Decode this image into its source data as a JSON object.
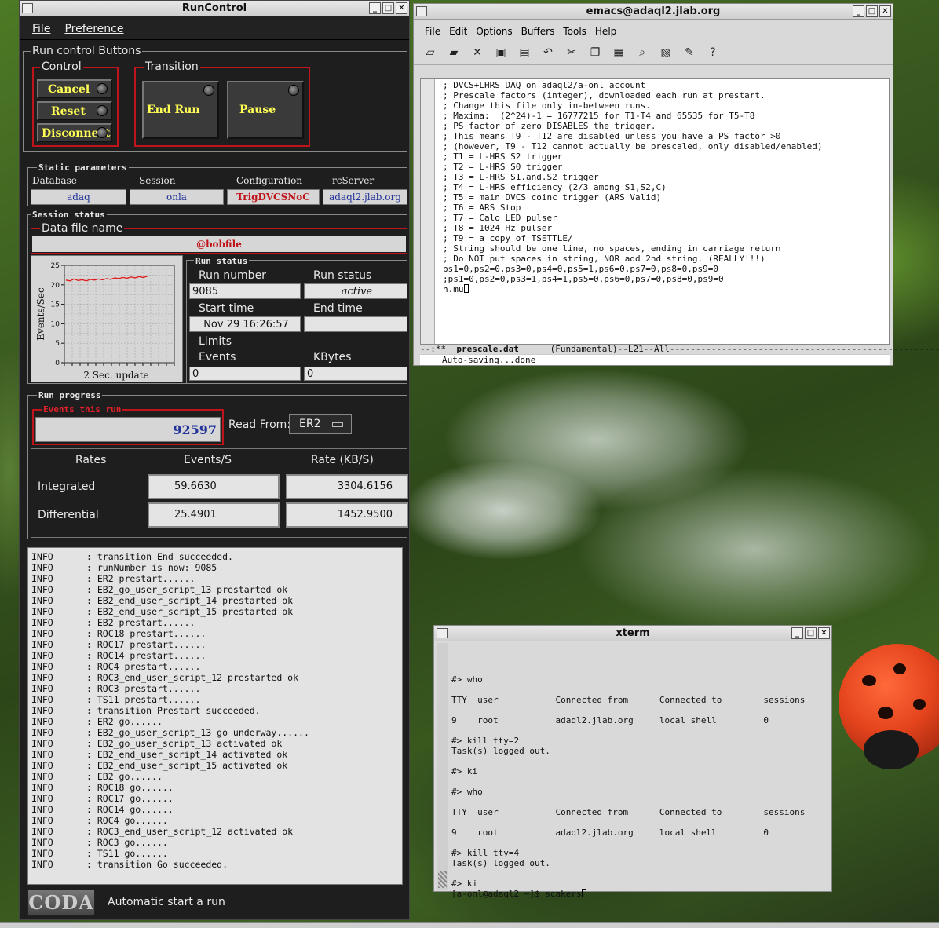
{
  "runcontrol": {
    "title": "RunControl",
    "menu": [
      "File",
      "Preference"
    ],
    "run_control_buttons_label": "Run control Buttons",
    "control_label": "Control",
    "transition_label": "Transition",
    "buttons": {
      "cancel": "Cancel",
      "reset": "Reset",
      "disconnect": "Disconnect",
      "end_run": "End Run",
      "pause": "Pause"
    },
    "static_params_label": "Static parameters",
    "database_label": "Database",
    "database": "adaq",
    "session_label": "Session",
    "session": "onla",
    "configuration_label": "Configuration",
    "configuration": "TrigDVCSNoC",
    "rcserver_label": "rcServer",
    "rcserver": "adaql2.jlab.org",
    "session_status_label": "Session status",
    "data_file_label": "Data file name",
    "data_file": "@bobfile",
    "chart_caption": "2 Sec. update",
    "chart_ylabel": "Events/Sec",
    "run_status_label": "Run status",
    "run_number_label": "Run number",
    "run_number": "9085",
    "run_status_field_label": "Run status",
    "run_status": "active",
    "start_time_label": "Start time",
    "start_time": "Nov 29 16:26:57",
    "end_time_label": "End time",
    "end_time": "",
    "limits_label": "Limits",
    "events_label": "Events",
    "events_limit": "0",
    "kbytes_label": "KBytes",
    "kbytes_limit": "0",
    "run_progress_label": "Run progress",
    "events_this_run_label": "Events this run",
    "events_this_run": "92597",
    "read_from_label": "Read From:",
    "read_from": "ER2",
    "rates_label": "Rates",
    "events_s_label": "Events/S",
    "rate_kbs_label": "Rate (KB/S)",
    "integrated_label": "Integrated",
    "integrated_events": "59.6630",
    "integrated_rate": "3304.6156",
    "differential_label": "Differential",
    "differential_events": "25.4901",
    "differential_rate": "1452.9500",
    "log": [
      [
        "INFO",
        ": transition End succeeded."
      ],
      [
        "INFO",
        ": runNumber is now: 9085"
      ],
      [
        "INFO",
        ": ER2 prestart......"
      ],
      [
        "INFO",
        ": EB2_go_user_script_13 prestarted ok"
      ],
      [
        "INFO",
        ": EB2_end_user_script_14 prestarted ok"
      ],
      [
        "INFO",
        ": EB2_end_user_script_15 prestarted ok"
      ],
      [
        "INFO",
        ": EB2 prestart......"
      ],
      [
        "INFO",
        ": ROC18 prestart......"
      ],
      [
        "INFO",
        ": ROC17 prestart......"
      ],
      [
        "INFO",
        ": ROC14 prestart......"
      ],
      [
        "INFO",
        ": ROC4 prestart......"
      ],
      [
        "INFO",
        ": ROC3_end_user_script_12 prestarted ok"
      ],
      [
        "INFO",
        ": ROC3 prestart......"
      ],
      [
        "INFO",
        ": TS11 prestart......"
      ],
      [
        "INFO",
        ": transition Prestart succeeded."
      ],
      [
        "INFO",
        ": ER2 go......"
      ],
      [
        "INFO",
        ": EB2_go_user_script_13 go underway......"
      ],
      [
        "INFO",
        ": EB2_go_user_script_13 activated ok"
      ],
      [
        "INFO",
        ": EB2_end_user_script_14 activated ok"
      ],
      [
        "INFO",
        ": EB2_end_user_script_15 activated ok"
      ],
      [
        "INFO",
        ": EB2 go......"
      ],
      [
        "INFO",
        ": ROC18 go......"
      ],
      [
        "INFO",
        ": ROC17 go......"
      ],
      [
        "INFO",
        ": ROC14 go......"
      ],
      [
        "INFO",
        ": ROC4 go......"
      ],
      [
        "INFO",
        ": ROC3_end_user_script_12 activated ok"
      ],
      [
        "INFO",
        ": ROC3 go......"
      ],
      [
        "INFO",
        ": TS11 go......"
      ],
      [
        "INFO",
        ": transition Go succeeded."
      ]
    ],
    "coda_logo": "CODA",
    "status_message": "Automatic start a run"
  },
  "chart_data": {
    "type": "line",
    "x": [
      0,
      1,
      2,
      3,
      4,
      5,
      6,
      7,
      8,
      9,
      10,
      11,
      12,
      13,
      14,
      15,
      16,
      17,
      18,
      19,
      20
    ],
    "series": [
      {
        "values": [
          21.2,
          21.0,
          21.5,
          21.1,
          21.3,
          21.0,
          21.4,
          21.2,
          21.5,
          21.3,
          21.6,
          21.4,
          21.8,
          21.6,
          21.9,
          21.7,
          22.0,
          21.8,
          22.1,
          21.9,
          22.2
        ]
      }
    ],
    "title": "",
    "xlabel": "2 Sec. update",
    "ylabel": "Events/Sec",
    "ylim": [
      0,
      25
    ],
    "yticks": [
      "25",
      "20",
      "15",
      "10",
      "5",
      "0"
    ],
    "grid": true,
    "line_color": "#e01818"
  },
  "emacs": {
    "title": "emacs@adaql2.jlab.org",
    "menu": [
      "File",
      "Edit",
      "Options",
      "Buffers",
      "Tools",
      "Help"
    ],
    "lines": [
      "; DVCS+LHRS DAQ on adaql2/a-onl account",
      "; Prescale factors (integer), downloaded each run at prestart.",
      "; Change this file only in-between runs.",
      "; Maxima:  (2^24)-1 = 16777215 for T1-T4 and 65535 for T5-T8",
      "; PS factor of zero DISABLES the trigger.",
      "; This means T9 - T12 are disabled unless you have a PS factor >0",
      "; (however, T9 - T12 cannot actually be prescaled, only disabled/enabled)",
      "; T1 = L-HRS S2 trigger",
      "; T2 = L-HRS S0 trigger",
      "; T3 = L-HRS S1.and.S2 trigger",
      "; T4 = L-HRS efficiency (2/3 among S1,S2,C)",
      "; T5 = main DVCS coinc trigger (ARS Valid)",
      "; T6 = ARS Stop",
      "; T7 = Calo LED pulser",
      "; T8 = 1024 Hz pulser",
      "; T9 = a copy of TSETTLE/",
      "; String should be one line, no spaces, ending in carriage return",
      "; Do NOT put spaces in string, NOR add 2nd string. (REALLY!!!)",
      "ps1=0,ps2=0,ps3=0,ps4=0,ps5=1,ps6=0,ps7=0,ps8=0,ps9=0",
      ";ps1=0,ps2=0,ps3=1,ps4=1,ps5=0,ps6=0,ps7=0,ps8=0,ps9=0",
      "n.mu"
    ],
    "modeline_prefix": "--:**  ",
    "buffer_name": "prescale.dat",
    "modeline_rest": "      (Fundamental)--L21--All",
    "minibuffer": "Auto-saving...done"
  },
  "xterm": {
    "title": "xterm",
    "lines": [
      {
        "t": "#> who",
        "y": 50
      },
      {
        "t": "TTY  user           Connected from      Connected to        sessions",
        "y": 76
      },
      {
        "t": "9    root           adaql2.jlab.org     local shell         0",
        "y": 102
      },
      {
        "t": "#> kill tty=2",
        "y": 128
      },
      {
        "t": "Task(s) logged out.",
        "y": 141
      },
      {
        "t": "#> ki",
        "y": 167
      },
      {
        "t": "#> who",
        "y": 193
      },
      {
        "t": "TTY  user           Connected from      Connected to        sessions",
        "y": 219
      },
      {
        "t": "9    root           adaql2.jlab.org     local shell         0",
        "y": 245
      },
      {
        "t": "#> kill tty=4",
        "y": 271
      },
      {
        "t": "Task(s) logged out.",
        "y": 284
      },
      {
        "t": "#> ki",
        "y": 310
      },
      {
        "t": "[a-onl@adaql2 ~]$ scakers",
        "y": 323
      }
    ]
  }
}
